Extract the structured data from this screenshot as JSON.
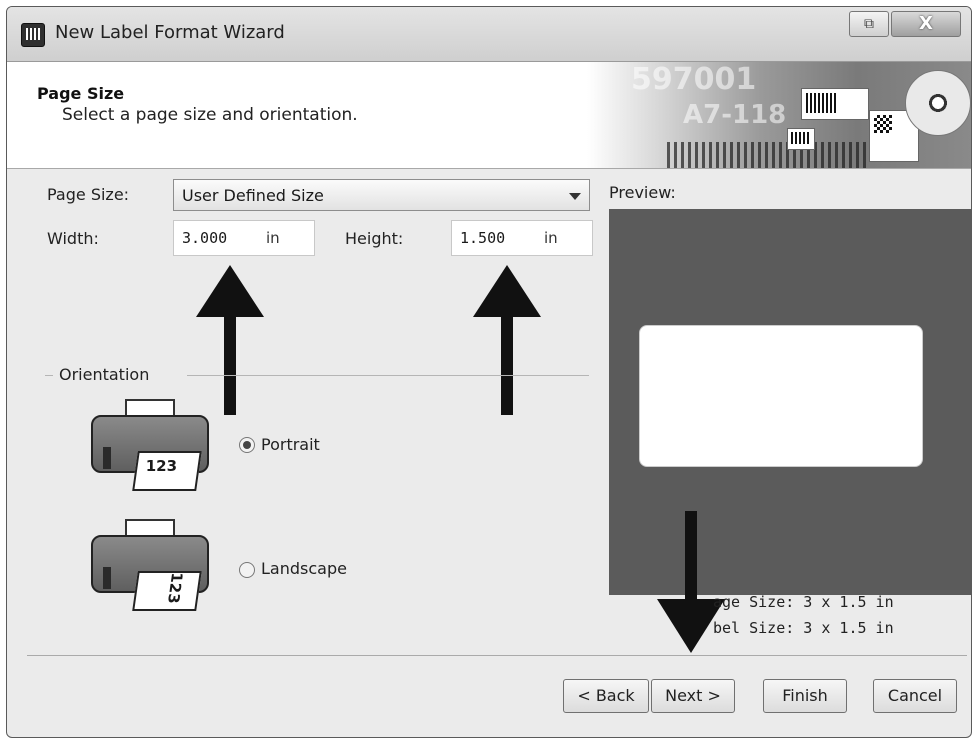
{
  "window": {
    "title": "New Label Format Wizard",
    "restore_glyph": "⧉",
    "close_glyph": "X"
  },
  "header": {
    "title": "Page Size",
    "subtitle": "Select a page size and orientation.",
    "banner_text_1": "597001",
    "banner_text_2": "A7-118"
  },
  "form": {
    "page_size_label": "Page Size:",
    "page_size_value": "User Defined Size",
    "width_label": "Width:",
    "width_value": "3.000",
    "width_unit": "in",
    "height_label": "Height:",
    "height_value": "1.500",
    "height_unit": "in"
  },
  "orientation": {
    "label": "Orientation",
    "portrait_label": "Portrait",
    "landscape_label": "Landscape",
    "printer_text": "123",
    "selected": "Portrait"
  },
  "preview": {
    "label": "Preview:",
    "page_size_text": "age Size:  3 x 1.5 in",
    "label_size_text": "bel Size:  3 x 1.5 in"
  },
  "footer": {
    "back_label": "< Back",
    "next_label": "Next >",
    "finish_label": "Finish",
    "cancel_label": "Cancel"
  },
  "colors": {
    "preview_bg": "#5b5b5b",
    "window_bg": "#ebebeb"
  }
}
